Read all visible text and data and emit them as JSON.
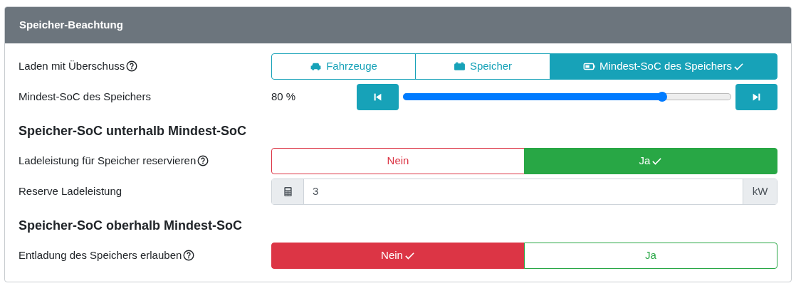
{
  "card": {
    "title": "Speicher-Beachtung"
  },
  "rows": [
    {
      "kind": "toggle",
      "label": "Laden mit Überschuss",
      "help": true,
      "options": [
        {
          "label": "Fahrzeuge",
          "kind": "info",
          "selected": false
        },
        {
          "label": "Speicher",
          "kind": "info",
          "selected": false
        },
        {
          "label": "Mindest-SoC des Speichers",
          "kind": "info",
          "selected": true
        }
      ]
    },
    {
      "kind": "slider",
      "label": "Mindest-SoC des Speichers",
      "reading": "80 %",
      "level": 0.79
    },
    {
      "kind": "heading",
      "label": "Speicher-SoC unterhalb Mindest-SoC"
    },
    {
      "kind": "toggle",
      "label": "Ladeleistung für Speicher reservieren",
      "help": true,
      "options": [
        {
          "label": "Nein",
          "kind": "danger",
          "selected": false
        },
        {
          "label": "Ja",
          "kind": "success",
          "selected": true
        }
      ]
    },
    {
      "kind": "input",
      "label": "Reserve Ladeleistung",
      "value": "3",
      "unit": "kW"
    },
    {
      "kind": "heading",
      "label": "Speicher-SoC oberhalb Mindest-SoC"
    },
    {
      "kind": "toggle",
      "label": "Entladung des Speichers erlauben",
      "help": true,
      "options": [
        {
          "label": "Nein",
          "kind": "danger",
          "selected": true
        },
        {
          "label": "Ja",
          "kind": "success",
          "selected": false
        }
      ]
    }
  ]
}
